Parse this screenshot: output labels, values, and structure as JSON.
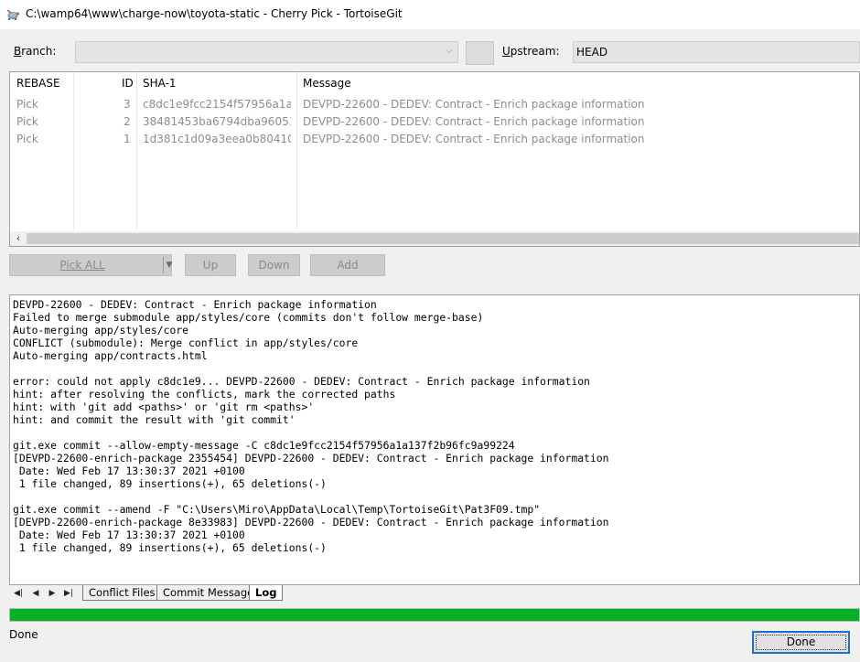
{
  "window": {
    "title": "C:\\wamp64\\www\\charge-now\\toyota-static - Cherry Pick - TortoiseGit",
    "icon": "tortoisegit-icon"
  },
  "branch": {
    "label_underlined": "B",
    "label_rest": "ranch:",
    "value": ""
  },
  "upstream": {
    "label_underlined": "U",
    "label_rest": "pstream:",
    "value": "HEAD"
  },
  "commit_list": {
    "columns": [
      "REBASE",
      "ID",
      "SHA-1",
      "Message"
    ],
    "rows": [
      {
        "action": "Pick",
        "id": "3",
        "sha": "c8dc1e9fcc2154f57956a1a13...",
        "message": "DEVPD-22600 - DEDEV: Contract - Enrich package information"
      },
      {
        "action": "Pick",
        "id": "2",
        "sha": "38481453ba6794dba9605189...",
        "message": "DEVPD-22600 - DEDEV: Contract - Enrich package information"
      },
      {
        "action": "Pick",
        "id": "1",
        "sha": "1d381c1d09a3eea0b8041011...",
        "message": "DEVPD-22600 - DEDEV: Contract - Enrich package information"
      }
    ]
  },
  "buttons": {
    "pick_all": "Pick ALL",
    "up": "Up",
    "down": "Down",
    "add": "Add",
    "done": "Done"
  },
  "log": {
    "lines": [
      "DEVPD-22600 - DEDEV: Contract - Enrich package information",
      "Failed to merge submodule app/styles/core (commits don't follow merge-base)",
      "Auto-merging app/styles/core",
      "CONFLICT (submodule): Merge conflict in app/styles/core",
      "Auto-merging app/contracts.html",
      "",
      "error: could not apply c8dc1e9... DEVPD-22600 - DEDEV: Contract - Enrich package information",
      "hint: after resolving the conflicts, mark the corrected paths",
      "hint: with 'git add <paths>' or 'git rm <paths>'",
      "hint: and commit the result with 'git commit'",
      "",
      "git.exe commit --allow-empty-message -C c8dc1e9fcc2154f57956a1a137f2b96fc9a99224",
      "[DEVPD-22600-enrich-package 2355454] DEVPD-22600 - DEDEV: Contract - Enrich package information",
      " Date: Wed Feb 17 13:30:37 2021 +0100",
      " 1 file changed, 89 insertions(+), 65 deletions(-)",
      "",
      "git.exe commit --amend -F \"C:\\Users\\Miro\\AppData\\Local\\Temp\\TortoiseGit\\Pat3F09.tmp\"",
      "[DEVPD-22600-enrich-package 8e33983] DEVPD-22600 - DEDEV: Contract - Enrich package information",
      " Date: Wed Feb 17 13:30:37 2021 +0100",
      " 1 file changed, 89 insertions(+), 65 deletions(-)"
    ]
  },
  "tabs": [
    {
      "label": "Conflict Files",
      "active": false
    },
    {
      "label": "Commit Message",
      "active": false
    },
    {
      "label": "Log",
      "active": true
    }
  ],
  "nav_icons": [
    "first-tab-icon",
    "prev-tab-icon",
    "next-tab-icon",
    "last-tab-icon"
  ],
  "progress": {
    "percent": 100,
    "color": "#06b025"
  },
  "status": {
    "text": "Done"
  }
}
